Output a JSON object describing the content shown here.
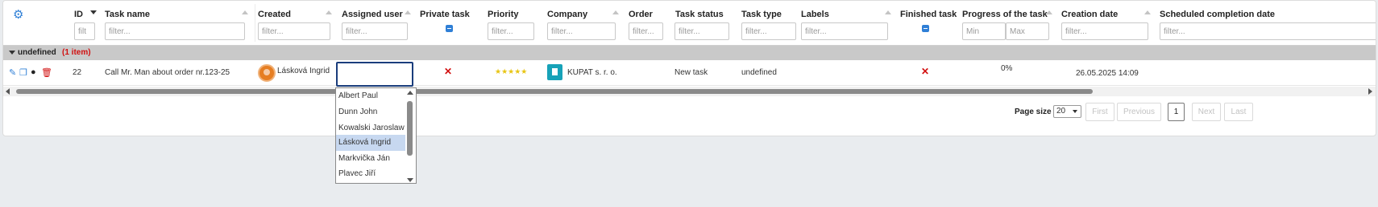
{
  "columns": {
    "id": {
      "label": "ID",
      "placeholder": "filt"
    },
    "task_name": {
      "label": "Task name",
      "placeholder": "filter..."
    },
    "created": {
      "label": "Created",
      "placeholder": "filter..."
    },
    "assigned_user": {
      "label": "Assigned user",
      "placeholder": "filter..."
    },
    "private_task": {
      "label": "Private task"
    },
    "priority": {
      "label": "Priority",
      "placeholder": "filter..."
    },
    "company": {
      "label": "Company",
      "placeholder": "filter..."
    },
    "order": {
      "label": "Order",
      "placeholder": "filter..."
    },
    "task_status": {
      "label": "Task status",
      "placeholder": "filter..."
    },
    "task_type": {
      "label": "Task type",
      "placeholder": "filter..."
    },
    "labels": {
      "label": "Labels",
      "placeholder": "filter..."
    },
    "finished_task": {
      "label": "Finished task"
    },
    "progress": {
      "label": "Progress of the task",
      "min_placeholder": "Min",
      "max_placeholder": "Max"
    },
    "creation_date": {
      "label": "Creation date",
      "placeholder": "filter..."
    },
    "scheduled_completion": {
      "label": "Scheduled completion date",
      "placeholder": "filter..."
    }
  },
  "group": {
    "name": "undefined",
    "count": "(1 item)"
  },
  "row": {
    "id": "22",
    "task_name": "Call Mr. Man about order nr.123-25",
    "created_by": "Lásková Ingrid",
    "private_task": "✕",
    "priority_stars": "★★★★★",
    "company": "KUPAT s. r. o.",
    "task_status": "New task",
    "task_type": "undefined",
    "finished_task": "✕",
    "progress": "0%",
    "creation_date": "26.05.2025 14:09"
  },
  "assigned_dropdown": {
    "options": [
      "Albert Paul",
      "Dunn John",
      "Kowalski Jaroslaw",
      "Lásková Ingrid",
      "Markvička Ján",
      "Plavec Jiří"
    ],
    "selected": "Lásková Ingrid"
  },
  "pagination": {
    "page_size_label": "Page size",
    "page_size": "20",
    "first": "First",
    "previous": "Previous",
    "current_page": "1",
    "next": "Next",
    "last": "Last"
  },
  "colors": {
    "accent": "#2f7fd6",
    "error": "#d10f0f",
    "group_bg": "#c9c9c9",
    "company_icon": "#17a2b8"
  }
}
